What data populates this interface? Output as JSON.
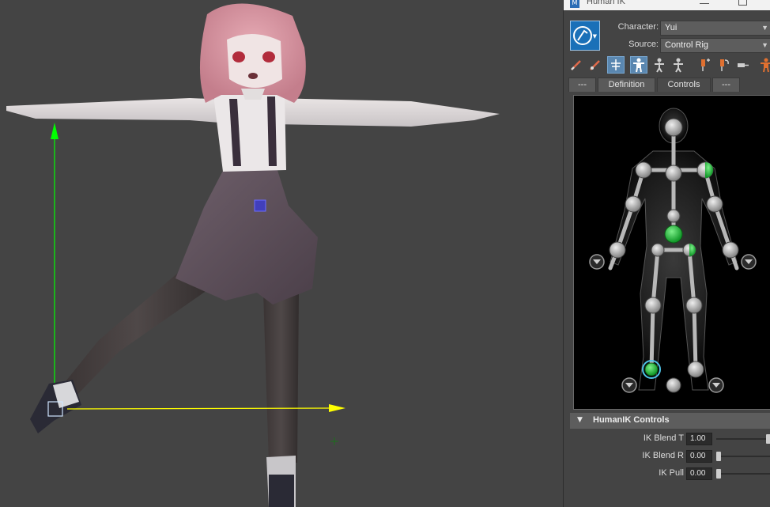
{
  "viewport": {
    "background": "#444444",
    "gizmo_y_color": "#00ff00",
    "gizmo_x_color": "#ffff00",
    "selection_color": "#3c3ccc"
  },
  "panel": {
    "title": "Human IK",
    "character_label": "Character:",
    "character_value": "Yui",
    "source_label": "Source:",
    "source_value": "Control Rig",
    "tabs": [
      {
        "label": "---"
      },
      {
        "label": "Definition"
      },
      {
        "label": "Controls"
      },
      {
        "label": "---"
      }
    ],
    "active_tab": "Controls",
    "figure": {
      "active_joint_color": "#27c93f",
      "inactive_joint_color": "#a8a8a8",
      "selected_ring_color": "#4fc3e8"
    },
    "controls_section": {
      "title": "HumanIK Controls",
      "params": [
        {
          "label": "IK Blend T",
          "value": "1.00",
          "level": 1.0
        },
        {
          "label": "IK Blend R",
          "value": "0.00",
          "level": 0.0
        },
        {
          "label": "IK Pull",
          "value": "0.00",
          "level": 0.0
        }
      ]
    },
    "toolbar_icons": [
      "pencil-icon",
      "pencil-alt-icon",
      "skeleton-icon",
      "full-body-icon",
      "body-part-icon",
      "stick-figure-icon",
      "pin-add-icon",
      "pin-rotate-icon",
      "key-left-icon",
      "figure-orange-icon"
    ]
  }
}
